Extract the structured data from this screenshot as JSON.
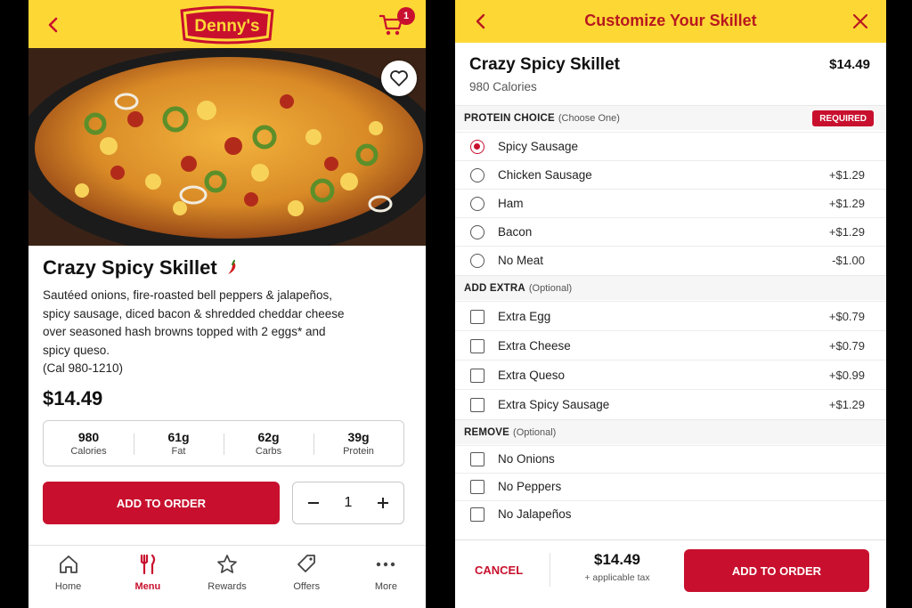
{
  "left": {
    "logo_text": "Denny's",
    "cart_count": "1",
    "product": {
      "name": "Crazy Spicy Skillet",
      "description": "Sautéed onions, fire-roasted bell peppers & jalapeños, spicy sausage, diced bacon & shredded cheddar cheese over seasoned hash browns topped with 2 eggs* and spicy queso.",
      "calorie_range": "(Cal 980-1210)",
      "price": "$14.49"
    },
    "nutrition": [
      {
        "value": "980",
        "label": "Calories"
      },
      {
        "value": "61g",
        "label": "Fat"
      },
      {
        "value": "62g",
        "label": "Carbs"
      },
      {
        "value": "39g",
        "label": "Protein"
      }
    ],
    "add_to_order": "ADD TO ORDER",
    "quantity": "1",
    "tabs": [
      {
        "label": "Home",
        "icon": "home-icon"
      },
      {
        "label": "Menu",
        "icon": "fork-knife-icon",
        "active": true
      },
      {
        "label": "Rewards",
        "icon": "star-icon"
      },
      {
        "label": "Offers",
        "icon": "tag-icon"
      },
      {
        "label": "More",
        "icon": "more-dots-icon"
      }
    ]
  },
  "right": {
    "header_title": "Customize Your Skillet",
    "item_name": "Crazy Spicy Skillet",
    "item_price": "$14.49",
    "calories": "980 Calories",
    "protein_section": {
      "title": "PROTEIN CHOICE",
      "subtitle": "(Choose One)",
      "badge": "REQUIRED"
    },
    "protein_options": [
      {
        "name": "Spicy Sausage",
        "price": "",
        "selected": true
      },
      {
        "name": "Chicken Sausage",
        "price": "+$1.29",
        "selected": false
      },
      {
        "name": "Ham",
        "price": "+$1.29",
        "selected": false
      },
      {
        "name": "Bacon",
        "price": "+$1.29",
        "selected": false
      },
      {
        "name": "No Meat",
        "price": "-$1.00",
        "selected": false
      }
    ],
    "extra_section": {
      "title": "ADD EXTRA",
      "subtitle": "(Optional)"
    },
    "extra_options": [
      {
        "name": "Extra Egg",
        "price": "+$0.79"
      },
      {
        "name": "Extra Cheese",
        "price": "+$0.79"
      },
      {
        "name": "Extra Queso",
        "price": "+$0.99"
      },
      {
        "name": "Extra Spicy Sausage",
        "price": "+$1.29"
      }
    ],
    "remove_section": {
      "title": "REMOVE",
      "subtitle": "(Optional)"
    },
    "remove_options": [
      {
        "name": "No Onions"
      },
      {
        "name": "No Peppers"
      },
      {
        "name": "No Jalapeños"
      }
    ],
    "footer": {
      "cancel": "CANCEL",
      "total": "$14.49",
      "tax_note": "+ applicable tax",
      "add_to_order": "ADD TO ORDER"
    }
  },
  "colors": {
    "brand_yellow": "#fdd835",
    "brand_red": "#c8102e"
  }
}
